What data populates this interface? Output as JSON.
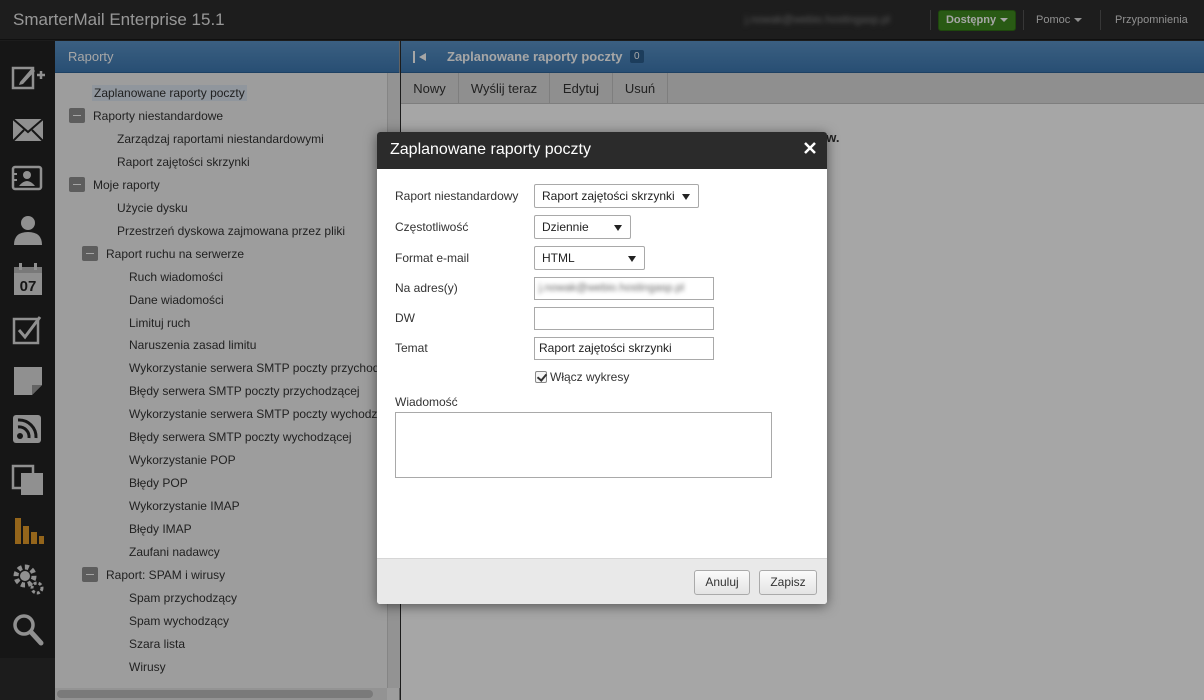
{
  "app": {
    "title": "SmarterMail Enterprise 15.1",
    "user_email": "j.nowak@webio.hostingasp.pl",
    "status_label": "Dostępny",
    "help_label": "Pomoc",
    "reminders_label": "Przypomnienia"
  },
  "rail_icons": [
    "compose-icon",
    "mail-icon",
    "contacts-icon",
    "user-icon",
    "calendar-icon",
    "tasks-icon",
    "notes-icon",
    "rss-icon",
    "files-icon",
    "reports-icon",
    "settings-icon",
    "search-icon"
  ],
  "calendar_day": "07",
  "left_panel": {
    "title": "Raporty",
    "tree": [
      {
        "label": "Zaplanowane raporty poczty",
        "level": 1,
        "selected": true
      },
      {
        "label": "Raporty niestandardowe",
        "level": 0,
        "group": true
      },
      {
        "label": "Zarządzaj raportami niestandardowymi",
        "level": 2
      },
      {
        "label": "Raport zajętości skrzynki",
        "level": 2
      },
      {
        "label": "Moje raporty",
        "level": 0,
        "group": true
      },
      {
        "label": "Użycie dysku",
        "level": 2
      },
      {
        "label": "Przestrzeń dyskowa zajmowana przez pliki",
        "level": 2
      },
      {
        "label": "Raport ruchu na serwerze",
        "level": 1,
        "group": true
      },
      {
        "label": "Ruch wiadomości",
        "level": 3
      },
      {
        "label": "Dane wiadomości",
        "level": 3
      },
      {
        "label": "Limituj ruch",
        "level": 3
      },
      {
        "label": "Naruszenia zasad limitu",
        "level": 3
      },
      {
        "label": "Wykorzystanie serwera SMTP poczty przychodzącej",
        "level": 3
      },
      {
        "label": "Błędy serwera SMTP poczty przychodzącej",
        "level": 3
      },
      {
        "label": "Wykorzystanie serwera SMTP poczty wychodzącej",
        "level": 3
      },
      {
        "label": "Błędy serwera SMTP poczty wychodzącej",
        "level": 3
      },
      {
        "label": "Wykorzystanie POP",
        "level": 3
      },
      {
        "label": "Błędy POP",
        "level": 3
      },
      {
        "label": "Wykorzystanie IMAP",
        "level": 3
      },
      {
        "label": "Błędy IMAP",
        "level": 3
      },
      {
        "label": "Zaufani nadawcy",
        "level": 3
      },
      {
        "label": "Raport: SPAM i wirusy",
        "level": 1,
        "group": true
      },
      {
        "label": "Spam przychodzący",
        "level": 3
      },
      {
        "label": "Spam wychodzący",
        "level": 3
      },
      {
        "label": "Szara lista",
        "level": 3
      },
      {
        "label": "Wirusy",
        "level": 3
      }
    ]
  },
  "right_panel": {
    "title": "Zaplanowane raporty poczty",
    "count": "0",
    "toolbar": [
      "Nowy",
      "Wyślij teraz",
      "Edytuj",
      "Usuń"
    ],
    "background_text": "tów."
  },
  "modal": {
    "title": "Zaplanowane raporty poczty",
    "fields": {
      "custom_report": {
        "label": "Raport niestandardowy",
        "value": "Raport zajętości skrzynki"
      },
      "frequency": {
        "label": "Częstotliwość",
        "value": "Dziennie"
      },
      "email_format": {
        "label": "Format e-mail",
        "value": "HTML"
      },
      "to_address": {
        "label": "Na adres(y)",
        "value": "j.nowak@webio.hostingasp.pl"
      },
      "cc": {
        "label": "DW",
        "value": ""
      },
      "subject": {
        "label": "Temat",
        "value": "Raport zajętości skrzynki"
      },
      "enable_charts": {
        "label": "Włącz wykresy",
        "checked": true
      },
      "message": {
        "label": "Wiadomość",
        "value": ""
      }
    },
    "cancel_label": "Anuluj",
    "save_label": "Zapisz"
  },
  "colors": {
    "header_blue": "#4a86bd",
    "status_green": "#3f8a1f",
    "rail_dark": "#232323",
    "accent_orange": "#e39b2a"
  }
}
